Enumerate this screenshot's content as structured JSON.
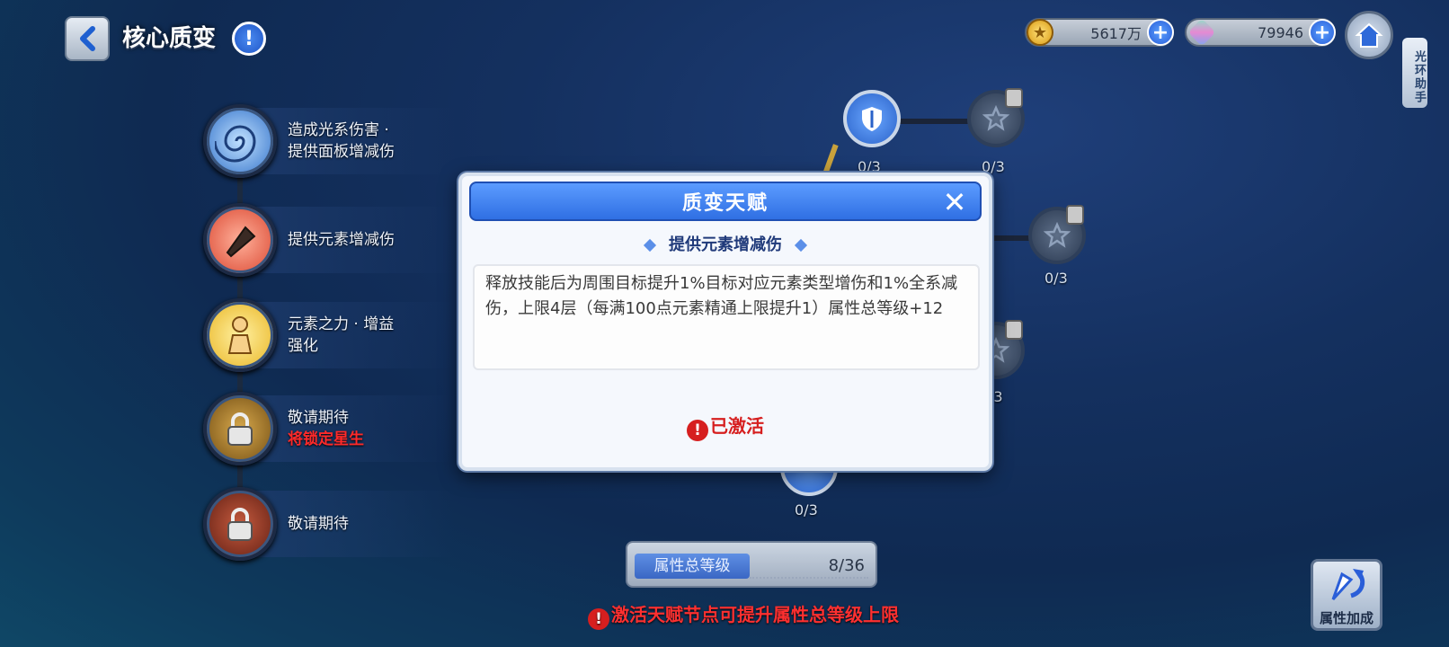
{
  "header": {
    "title": "核心质变",
    "help_icon": "!",
    "gold_amount": "5617万",
    "gem_amount": "79946",
    "helper_tab": "光环助手"
  },
  "talents": [
    {
      "label": "造成光系伤害 · 提供面板增减伤",
      "sub": "",
      "icon": "swirl-icon",
      "color": "#2f6fc8"
    },
    {
      "label": "提供元素增减伤",
      "sub": "",
      "icon": "missile-icon",
      "color": "#d9442e"
    },
    {
      "label": "元素之力 · 增益强化",
      "sub": "",
      "icon": "figure-icon",
      "color": "#e8b320"
    },
    {
      "label": "敬请期待",
      "sub": "将锁定星生",
      "icon": "lock-icon",
      "color": "#9c6b18"
    },
    {
      "label": "敬请期待",
      "sub": "",
      "icon": "lock-icon",
      "color": "#8a2e1c"
    }
  ],
  "tree": {
    "nodes": [
      {
        "label": "0/3",
        "state": "active"
      },
      {
        "label": "0/3",
        "state": "locked"
      },
      {
        "label": "0/3",
        "state": "locked"
      },
      {
        "label": "/3",
        "state": "locked"
      },
      {
        "label": "0/3",
        "state": "active"
      }
    ]
  },
  "modal": {
    "title": "质变天赋",
    "close_icon": "✕",
    "subtitle": "提供元素增减伤",
    "description": "释放技能后为周围目标提升1%目标对应元素类型增伤和1%全系减伤，上限4层（每满100点元素精通上限提升1）属性总等级+12",
    "status": "已激活"
  },
  "footer": {
    "level_label": "属性总等级",
    "level_value": "8/36",
    "hint": "激活天赋节点可提升属性总等级上限",
    "attr_button": "属性加成"
  }
}
